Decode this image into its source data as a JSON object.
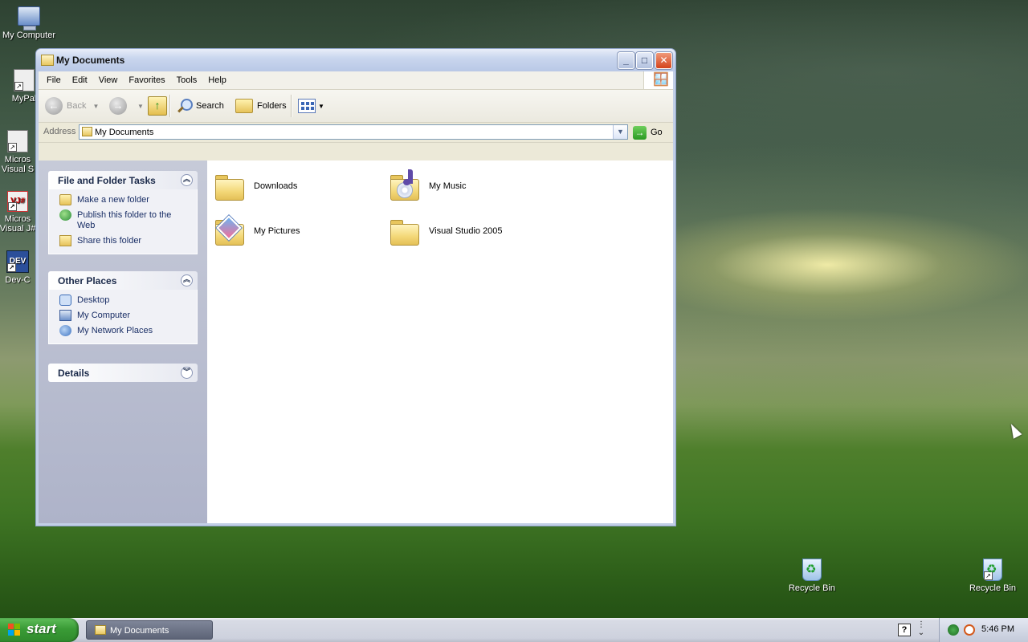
{
  "desktop": {
    "icons": [
      {
        "label": "My Computer"
      },
      {
        "label": "MyPal"
      },
      {
        "label": "Micros Visual S"
      },
      {
        "label": "Micros Visual J#"
      },
      {
        "label": "Dev-C"
      },
      {
        "label": "Recycle Bin"
      },
      {
        "label": "Recycle Bin"
      }
    ],
    "icon_glyphs": {
      "vj": "VJ#",
      "dev": "DEV"
    }
  },
  "window": {
    "title": "My Documents",
    "controls": {
      "minimize": "_",
      "maximize": "□",
      "close": "✕"
    },
    "menu": [
      "File",
      "Edit",
      "View",
      "Favorites",
      "Tools",
      "Help"
    ],
    "toolbar": {
      "back_label": "Back",
      "search_label": "Search",
      "folders_label": "Folders"
    },
    "address": {
      "label": "Address",
      "value": "My Documents",
      "go_label": "Go"
    },
    "taskpane": {
      "file_tasks": {
        "title": "File and Folder Tasks",
        "items": [
          "Make a new folder",
          "Publish this folder to the Web",
          "Share this folder"
        ]
      },
      "other_places": {
        "title": "Other Places",
        "items": [
          "Desktop",
          "My Computer",
          "My Network Places"
        ]
      },
      "details": {
        "title": "Details"
      }
    },
    "files": [
      "Downloads",
      "My Music",
      "My Pictures",
      "Visual Studio 2005"
    ]
  },
  "taskbar": {
    "start_label": "start",
    "task_label": "My Documents",
    "clock": "5:46 PM",
    "help_glyph": "?"
  },
  "colors": {
    "start_green": "#3a9b36",
    "taskpane_grey": "#aeb3c9",
    "link_blue": "#1a2f66"
  }
}
